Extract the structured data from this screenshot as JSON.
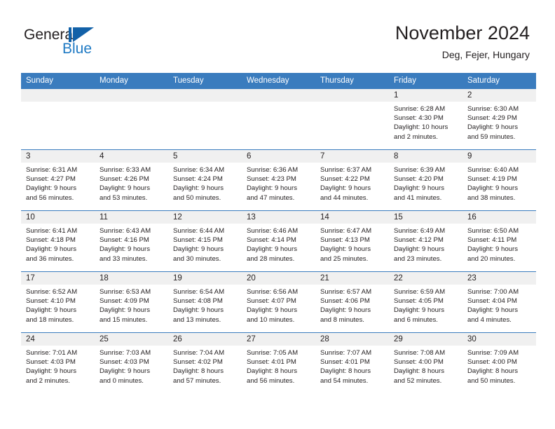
{
  "brand": {
    "name_part1": "General",
    "name_part2": "Blue",
    "accent_color": "#1261a8",
    "text_color": "#231f20"
  },
  "header": {
    "title": "November 2024",
    "subtitle": "Deg, Fejer, Hungary"
  },
  "theme": {
    "header_row_bg": "#3a7cbe",
    "date_cell_bg": "#f0f0f0",
    "grid_line": "#3a7cbe"
  },
  "weekday_headers": [
    "Sunday",
    "Monday",
    "Tuesday",
    "Wednesday",
    "Thursday",
    "Friday",
    "Saturday"
  ],
  "weeks": [
    [
      {
        "date": "",
        "sunrise": "",
        "sunset": "",
        "daylight_line1": "",
        "daylight_line2": ""
      },
      {
        "date": "",
        "sunrise": "",
        "sunset": "",
        "daylight_line1": "",
        "daylight_line2": ""
      },
      {
        "date": "",
        "sunrise": "",
        "sunset": "",
        "daylight_line1": "",
        "daylight_line2": ""
      },
      {
        "date": "",
        "sunrise": "",
        "sunset": "",
        "daylight_line1": "",
        "daylight_line2": ""
      },
      {
        "date": "",
        "sunrise": "",
        "sunset": "",
        "daylight_line1": "",
        "daylight_line2": ""
      },
      {
        "date": "1",
        "sunrise": "Sunrise: 6:28 AM",
        "sunset": "Sunset: 4:30 PM",
        "daylight_line1": "Daylight: 10 hours",
        "daylight_line2": "and 2 minutes."
      },
      {
        "date": "2",
        "sunrise": "Sunrise: 6:30 AM",
        "sunset": "Sunset: 4:29 PM",
        "daylight_line1": "Daylight: 9 hours",
        "daylight_line2": "and 59 minutes."
      }
    ],
    [
      {
        "date": "3",
        "sunrise": "Sunrise: 6:31 AM",
        "sunset": "Sunset: 4:27 PM",
        "daylight_line1": "Daylight: 9 hours",
        "daylight_line2": "and 56 minutes."
      },
      {
        "date": "4",
        "sunrise": "Sunrise: 6:33 AM",
        "sunset": "Sunset: 4:26 PM",
        "daylight_line1": "Daylight: 9 hours",
        "daylight_line2": "and 53 minutes."
      },
      {
        "date": "5",
        "sunrise": "Sunrise: 6:34 AM",
        "sunset": "Sunset: 4:24 PM",
        "daylight_line1": "Daylight: 9 hours",
        "daylight_line2": "and 50 minutes."
      },
      {
        "date": "6",
        "sunrise": "Sunrise: 6:36 AM",
        "sunset": "Sunset: 4:23 PM",
        "daylight_line1": "Daylight: 9 hours",
        "daylight_line2": "and 47 minutes."
      },
      {
        "date": "7",
        "sunrise": "Sunrise: 6:37 AM",
        "sunset": "Sunset: 4:22 PM",
        "daylight_line1": "Daylight: 9 hours",
        "daylight_line2": "and 44 minutes."
      },
      {
        "date": "8",
        "sunrise": "Sunrise: 6:39 AM",
        "sunset": "Sunset: 4:20 PM",
        "daylight_line1": "Daylight: 9 hours",
        "daylight_line2": "and 41 minutes."
      },
      {
        "date": "9",
        "sunrise": "Sunrise: 6:40 AM",
        "sunset": "Sunset: 4:19 PM",
        "daylight_line1": "Daylight: 9 hours",
        "daylight_line2": "and 38 minutes."
      }
    ],
    [
      {
        "date": "10",
        "sunrise": "Sunrise: 6:41 AM",
        "sunset": "Sunset: 4:18 PM",
        "daylight_line1": "Daylight: 9 hours",
        "daylight_line2": "and 36 minutes."
      },
      {
        "date": "11",
        "sunrise": "Sunrise: 6:43 AM",
        "sunset": "Sunset: 4:16 PM",
        "daylight_line1": "Daylight: 9 hours",
        "daylight_line2": "and 33 minutes."
      },
      {
        "date": "12",
        "sunrise": "Sunrise: 6:44 AM",
        "sunset": "Sunset: 4:15 PM",
        "daylight_line1": "Daylight: 9 hours",
        "daylight_line2": "and 30 minutes."
      },
      {
        "date": "13",
        "sunrise": "Sunrise: 6:46 AM",
        "sunset": "Sunset: 4:14 PM",
        "daylight_line1": "Daylight: 9 hours",
        "daylight_line2": "and 28 minutes."
      },
      {
        "date": "14",
        "sunrise": "Sunrise: 6:47 AM",
        "sunset": "Sunset: 4:13 PM",
        "daylight_line1": "Daylight: 9 hours",
        "daylight_line2": "and 25 minutes."
      },
      {
        "date": "15",
        "sunrise": "Sunrise: 6:49 AM",
        "sunset": "Sunset: 4:12 PM",
        "daylight_line1": "Daylight: 9 hours",
        "daylight_line2": "and 23 minutes."
      },
      {
        "date": "16",
        "sunrise": "Sunrise: 6:50 AM",
        "sunset": "Sunset: 4:11 PM",
        "daylight_line1": "Daylight: 9 hours",
        "daylight_line2": "and 20 minutes."
      }
    ],
    [
      {
        "date": "17",
        "sunrise": "Sunrise: 6:52 AM",
        "sunset": "Sunset: 4:10 PM",
        "daylight_line1": "Daylight: 9 hours",
        "daylight_line2": "and 18 minutes."
      },
      {
        "date": "18",
        "sunrise": "Sunrise: 6:53 AM",
        "sunset": "Sunset: 4:09 PM",
        "daylight_line1": "Daylight: 9 hours",
        "daylight_line2": "and 15 minutes."
      },
      {
        "date": "19",
        "sunrise": "Sunrise: 6:54 AM",
        "sunset": "Sunset: 4:08 PM",
        "daylight_line1": "Daylight: 9 hours",
        "daylight_line2": "and 13 minutes."
      },
      {
        "date": "20",
        "sunrise": "Sunrise: 6:56 AM",
        "sunset": "Sunset: 4:07 PM",
        "daylight_line1": "Daylight: 9 hours",
        "daylight_line2": "and 10 minutes."
      },
      {
        "date": "21",
        "sunrise": "Sunrise: 6:57 AM",
        "sunset": "Sunset: 4:06 PM",
        "daylight_line1": "Daylight: 9 hours",
        "daylight_line2": "and 8 minutes."
      },
      {
        "date": "22",
        "sunrise": "Sunrise: 6:59 AM",
        "sunset": "Sunset: 4:05 PM",
        "daylight_line1": "Daylight: 9 hours",
        "daylight_line2": "and 6 minutes."
      },
      {
        "date": "23",
        "sunrise": "Sunrise: 7:00 AM",
        "sunset": "Sunset: 4:04 PM",
        "daylight_line1": "Daylight: 9 hours",
        "daylight_line2": "and 4 minutes."
      }
    ],
    [
      {
        "date": "24",
        "sunrise": "Sunrise: 7:01 AM",
        "sunset": "Sunset: 4:03 PM",
        "daylight_line1": "Daylight: 9 hours",
        "daylight_line2": "and 2 minutes."
      },
      {
        "date": "25",
        "sunrise": "Sunrise: 7:03 AM",
        "sunset": "Sunset: 4:03 PM",
        "daylight_line1": "Daylight: 9 hours",
        "daylight_line2": "and 0 minutes."
      },
      {
        "date": "26",
        "sunrise": "Sunrise: 7:04 AM",
        "sunset": "Sunset: 4:02 PM",
        "daylight_line1": "Daylight: 8 hours",
        "daylight_line2": "and 57 minutes."
      },
      {
        "date": "27",
        "sunrise": "Sunrise: 7:05 AM",
        "sunset": "Sunset: 4:01 PM",
        "daylight_line1": "Daylight: 8 hours",
        "daylight_line2": "and 56 minutes."
      },
      {
        "date": "28",
        "sunrise": "Sunrise: 7:07 AM",
        "sunset": "Sunset: 4:01 PM",
        "daylight_line1": "Daylight: 8 hours",
        "daylight_line2": "and 54 minutes."
      },
      {
        "date": "29",
        "sunrise": "Sunrise: 7:08 AM",
        "sunset": "Sunset: 4:00 PM",
        "daylight_line1": "Daylight: 8 hours",
        "daylight_line2": "and 52 minutes."
      },
      {
        "date": "30",
        "sunrise": "Sunrise: 7:09 AM",
        "sunset": "Sunset: 4:00 PM",
        "daylight_line1": "Daylight: 8 hours",
        "daylight_line2": "and 50 minutes."
      }
    ]
  ]
}
